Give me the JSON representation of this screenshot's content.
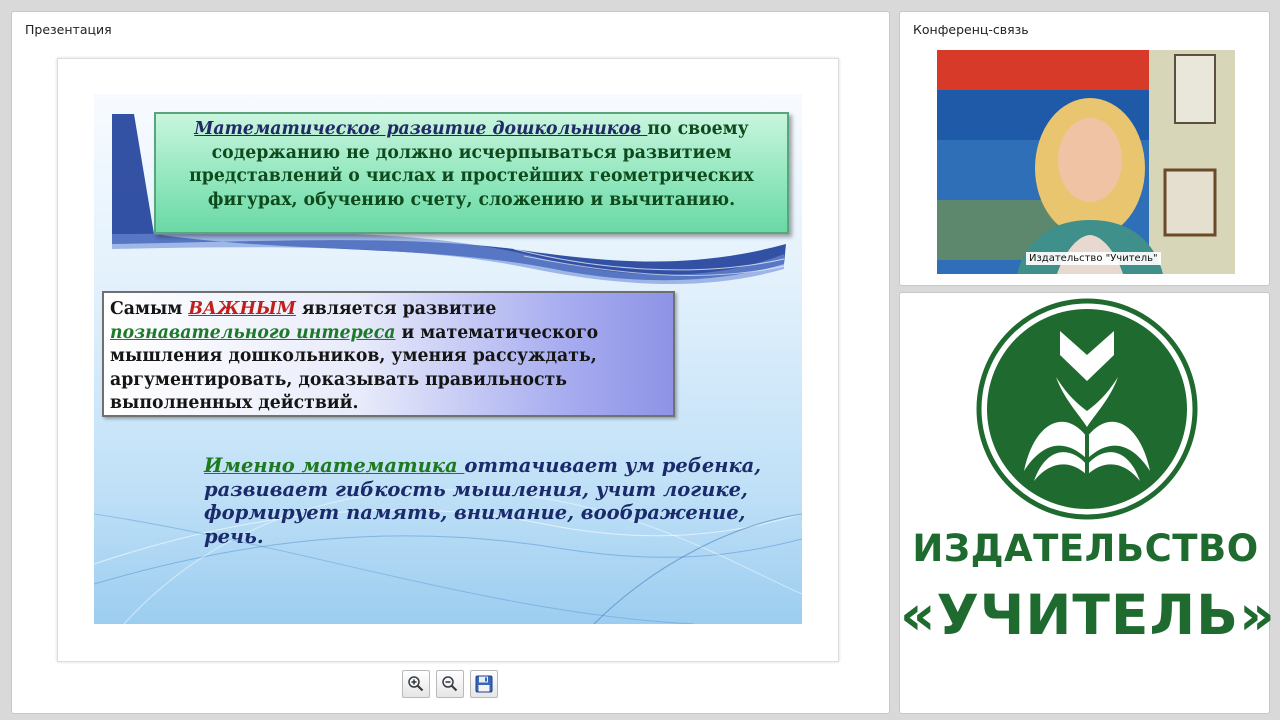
{
  "presentation": {
    "title": "Презентация",
    "slide": {
      "box1": {
        "lead": "Математическое развитие дошкольников ",
        "rest": "по своему содержанию не должно исчерпываться  развитием представлений о числах и простейших геометрических фигурах, обучению счету, сложению и вычитанию."
      },
      "box2": {
        "t1": "Самым ",
        "em": "ВАЖНЫМ",
        "t2": " является развитие ",
        "green": "познавательного интереса",
        "t3": " и математического мышления дошкольников, умения рассуждать, аргументировать, доказывать правильность выполненных действий."
      },
      "para3": {
        "lead": "Именно математика ",
        "rest": "оттачивает ум ребенка, развивает гибкость мышления, учит логике, формирует память, внимание, воображение, речь."
      }
    },
    "toolbar": {
      "zoom_in_icon": "zoom-in-icon",
      "zoom_out_icon": "zoom-out-icon",
      "save_icon": "floppy-disk-icon"
    }
  },
  "conference": {
    "title": "Конференц-связь",
    "participant_label": "Издательство \"Учитель\""
  },
  "logo": {
    "line1": "ИЗДАТЕЛЬСТВО",
    "line2": "«УЧИТЕЛЬ»",
    "brand_color": "#1e6a2f"
  }
}
